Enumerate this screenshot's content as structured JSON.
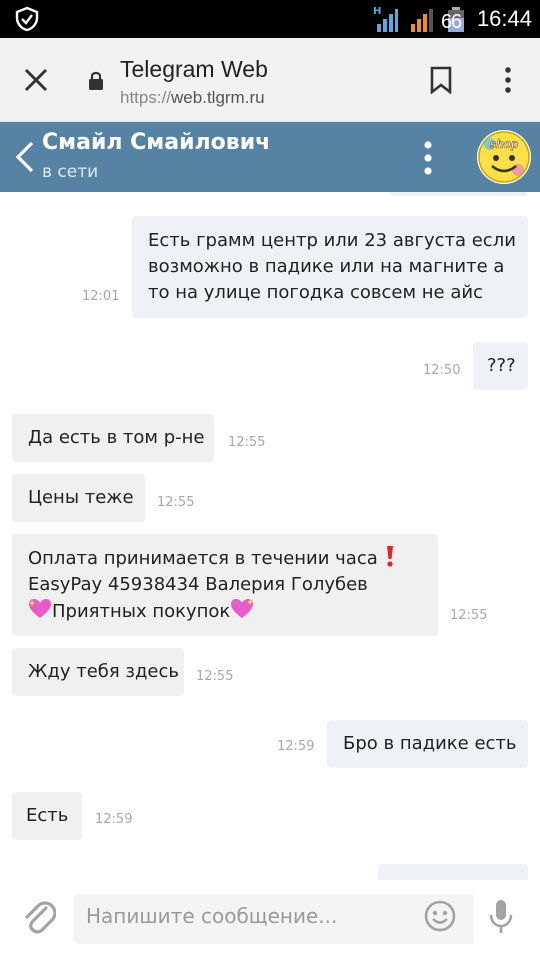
{
  "statusbar": {
    "time": "16:44",
    "battery_text": "66",
    "net_label": "H"
  },
  "browser": {
    "title": "Telegram Web",
    "url_scheme": "https://",
    "url_host": "web.tlgrm.ru"
  },
  "chat": {
    "name": "Смайл Смайлович",
    "status": "в сети",
    "avatar_text": "shop"
  },
  "messages": [
    {
      "dir": "out",
      "lines": [
        "Есть грамм центр или 23 августа если",
        "возможно в падике или на магните а",
        "то на улице погодка совсем не айс"
      ],
      "time": "12:01"
    },
    {
      "dir": "out",
      "lines": [
        "???"
      ],
      "time": "12:50"
    },
    {
      "dir": "in",
      "lines": [
        "Да есть в том р-не"
      ],
      "time": "12:55"
    },
    {
      "dir": "in",
      "lines": [
        "Цены теже"
      ],
      "time": "12:55"
    },
    {
      "dir": "in",
      "lines": [
        "Оплата принимается в течении часа",
        "EasyPay 45938434 Валерия Голубев",
        "Приятных покупок"
      ],
      "time": "12:55"
    },
    {
      "dir": "in",
      "lines": [
        "Жду тебя здесь"
      ],
      "time": "12:55"
    },
    {
      "dir": "out",
      "lines": [
        "Бро в падике есть"
      ],
      "time": "12:59"
    },
    {
      "dir": "in",
      "lines": [
        "Есть"
      ],
      "time": "12:59"
    }
  ],
  "composer": {
    "placeholder": "Напишите сообщение..."
  },
  "colors": {
    "header": "#5682a3",
    "incoming_bubble": "#f0f0f0",
    "outgoing_bubble": "#eef2f6"
  },
  "icons": [
    "shield-icon",
    "signal-icon",
    "battery-icon",
    "close-icon",
    "lock-icon",
    "bookmark-icon",
    "more-vert-icon",
    "back-chevron-icon",
    "kebab-menu-icon",
    "paperclip-icon",
    "smiley-icon",
    "microphone-icon",
    "exclamation-emoji",
    "sparkling-heart-emoji"
  ]
}
